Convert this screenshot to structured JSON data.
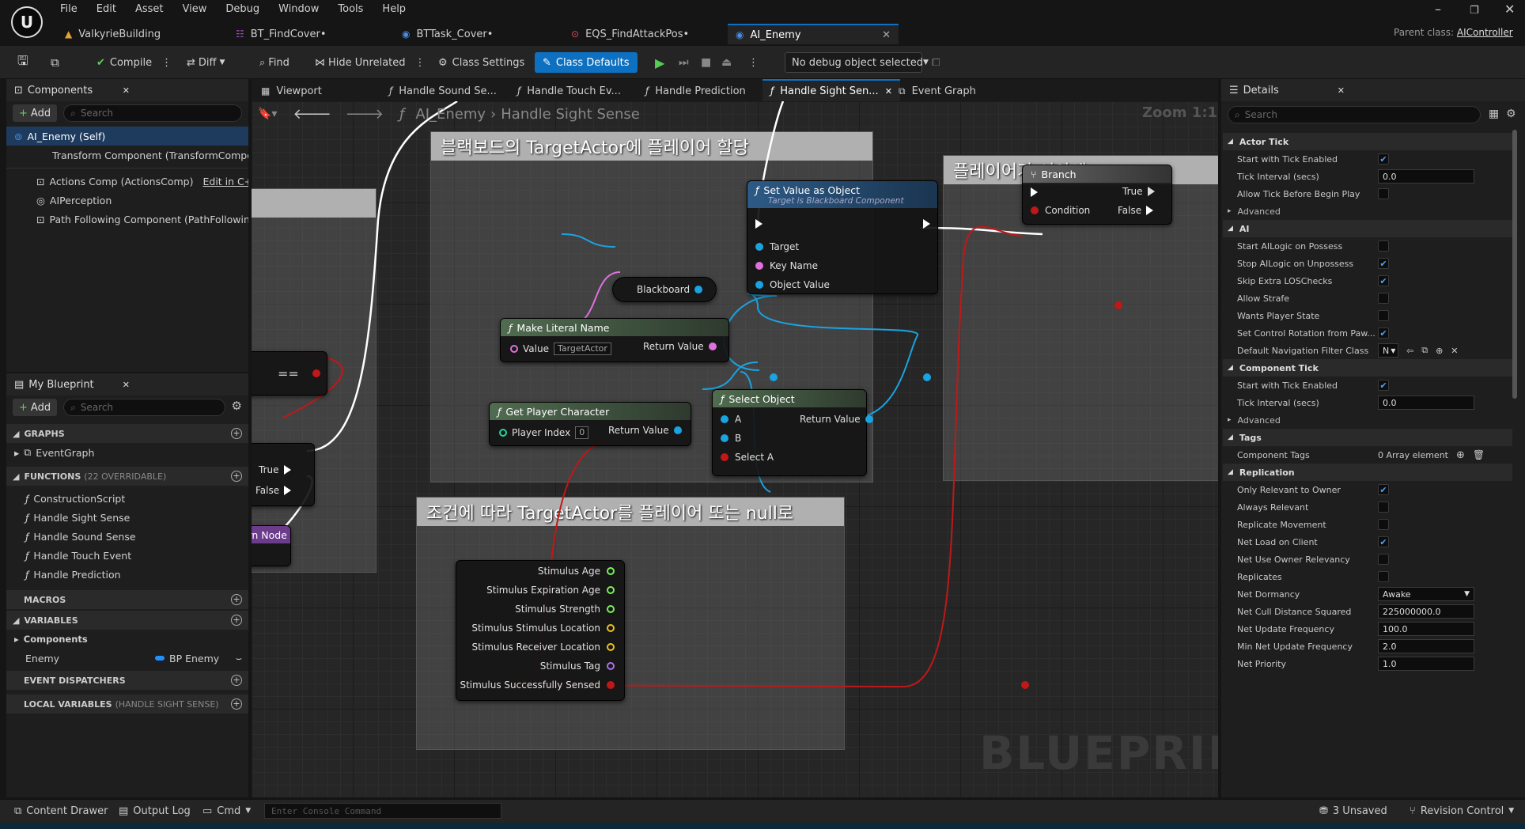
{
  "menu": [
    "File",
    "Edit",
    "Asset",
    "View",
    "Debug",
    "Window",
    "Tools",
    "Help"
  ],
  "tabs": [
    {
      "label": "ValkyrieBuilding",
      "icon": "▲",
      "color": "#e3a23a"
    },
    {
      "label": "BT_FindCover•",
      "icon": "☷",
      "color": "#a050c8"
    },
    {
      "label": "BTTask_Cover•",
      "icon": "◉",
      "color": "#4a8ae0"
    },
    {
      "label": "EQS_FindAttackPos•",
      "icon": "⊙",
      "color": "#e05060"
    },
    {
      "label": "AI_Enemy",
      "icon": "◉",
      "color": "#4a8ae0"
    }
  ],
  "parent_class": {
    "label": "Parent class:",
    "value": "AIController"
  },
  "toolbar": {
    "compile": "Compile",
    "diff": "Diff",
    "find": "Find",
    "hide_unrelated": "Hide Unrelated",
    "class_settings": "Class Settings",
    "class_defaults": "Class Defaults",
    "debug_object": "No debug object selected"
  },
  "components": {
    "title": "Components",
    "add": "Add",
    "search": "Search",
    "root": "AI_Enemy (Self)",
    "items": [
      {
        "label": "Transform Component (TransformCompon"
      },
      {
        "label": "Actions Comp (ActionsComp)",
        "extra": "Edit in C++"
      },
      {
        "label": "AIPerception"
      },
      {
        "label": "Path Following Component (PathFollowingC"
      }
    ]
  },
  "my_blueprint": {
    "title": "My Blueprint",
    "add": "Add",
    "search": "Search",
    "graphs": "GRAPHS",
    "event_graph": "EventGraph",
    "functions": "FUNCTIONS",
    "functions_note": "(22 OVERRIDABLE)",
    "function_items": [
      "ConstructionScript",
      "Handle Sight Sense",
      "Handle Sound Sense",
      "Handle Touch Event",
      "Handle Prediction"
    ],
    "macros": "MACROS",
    "variables": "VARIABLES",
    "var_components": "Components",
    "var_name": "Enemy",
    "var_type": "BP Enemy",
    "dispatchers": "EVENT DISPATCHERS",
    "locals": "LOCAL VARIABLES",
    "locals_note": "(HANDLE SIGHT SENSE)"
  },
  "graph_tabs": [
    "Viewport",
    "Handle Sound Se...",
    "Handle Touch Ev...",
    "Handle Prediction",
    "Handle Sight Sen...",
    "Event Graph"
  ],
  "breadcrumb": {
    "root": "AI_Enemy",
    "current": "Handle Sight Sense",
    "zoom": "Zoom 1:1"
  },
  "watermark": "BLUEPRINT",
  "comments": {
    "c1": "블랙보드의 TargetActor에 플레이어 할당",
    "c2": "조건에 따라 TargetActor를 플레이어 또는 null로",
    "c3": "플레이어가 시야에"
  },
  "nodes": {
    "set_value": {
      "title": "Set Value as Object",
      "subtitle": "Target is Blackboard Component",
      "target": "Target",
      "key": "Key Name",
      "obj": "Object Value"
    },
    "blackboard": "Blackboard",
    "make_literal": {
      "title": "Make Literal Name",
      "value": "Value",
      "field": "TargetActor",
      "ret": "Return Value"
    },
    "get_player": {
      "title": "Get Player Character",
      "index": "Player Index",
      "field": "0",
      "ret": "Return Value"
    },
    "select": {
      "title": "Select Object",
      "a": "A",
      "b": "B",
      "sel": "Select A",
      "ret": "Return Value"
    },
    "branch": {
      "title": "Branch",
      "cond": "Condition",
      "t": "True",
      "f": "False"
    },
    "eq": "==",
    "left_branch": {
      "t": "True",
      "f": "False"
    },
    "return_node": "Return Node",
    "stimulus": [
      "Stimulus Age",
      "Stimulus Expiration Age",
      "Stimulus Strength",
      "Stimulus Stimulus Location",
      "Stimulus Receiver Location",
      "Stimulus Tag",
      "Stimulus Successfully Sensed"
    ]
  },
  "details": {
    "title": "Details",
    "search": "Search",
    "sections": [
      {
        "name": "Actor Tick",
        "rows": [
          {
            "l": "Start with Tick Enabled",
            "c": true
          },
          {
            "l": "Tick Interval (secs)",
            "v": "0.0"
          },
          {
            "l": "Allow Tick Before Begin Play",
            "c": false
          }
        ],
        "adv": "Advanced"
      },
      {
        "name": "AI",
        "rows": [
          {
            "l": "Start AILogic on Possess",
            "c": false
          },
          {
            "l": "Stop AILogic on Unpossess",
            "c": true
          },
          {
            "l": "Skip Extra LOSChecks",
            "c": true
          },
          {
            "l": "Allow Strafe",
            "c": false
          },
          {
            "l": "Wants Player State",
            "c": false
          },
          {
            "l": "Set Control Rotation from Paw...",
            "c": true
          },
          {
            "l": "Default Navigation Filter Class",
            "v": "N"
          }
        ]
      },
      {
        "name": "Component Tick",
        "rows": [
          {
            "l": "Start with Tick Enabled",
            "c": true
          },
          {
            "l": "Tick Interval (secs)",
            "v": "0.0"
          }
        ],
        "adv": "Advanced"
      },
      {
        "name": "Tags",
        "rows": [
          {
            "l": "Component Tags",
            "t": "0 Array element"
          }
        ]
      },
      {
        "name": "Replication",
        "rows": [
          {
            "l": "Only Relevant to Owner",
            "c": true
          },
          {
            "l": "Always Relevant",
            "c": false
          },
          {
            "l": "Replicate Movement",
            "c": false
          },
          {
            "l": "Net Load on Client",
            "c": true
          },
          {
            "l": "Net Use Owner Relevancy",
            "c": false
          },
          {
            "l": "Replicates",
            "c": false
          },
          {
            "l": "Net Dormancy",
            "v": "Awake",
            "dd": true
          },
          {
            "l": "Net Cull Distance Squared",
            "v": "225000000.0"
          },
          {
            "l": "Net Update Frequency",
            "v": "100.0"
          },
          {
            "l": "Min Net Update Frequency",
            "v": "2.0"
          },
          {
            "l": "Net Priority",
            "v": "1.0"
          }
        ]
      }
    ]
  },
  "status": {
    "content_drawer": "Content Drawer",
    "output_log": "Output Log",
    "cmd": "Cmd",
    "console_placeholder": "Enter Console Command",
    "unsaved": "3 Unsaved",
    "revision": "Revision Control"
  }
}
